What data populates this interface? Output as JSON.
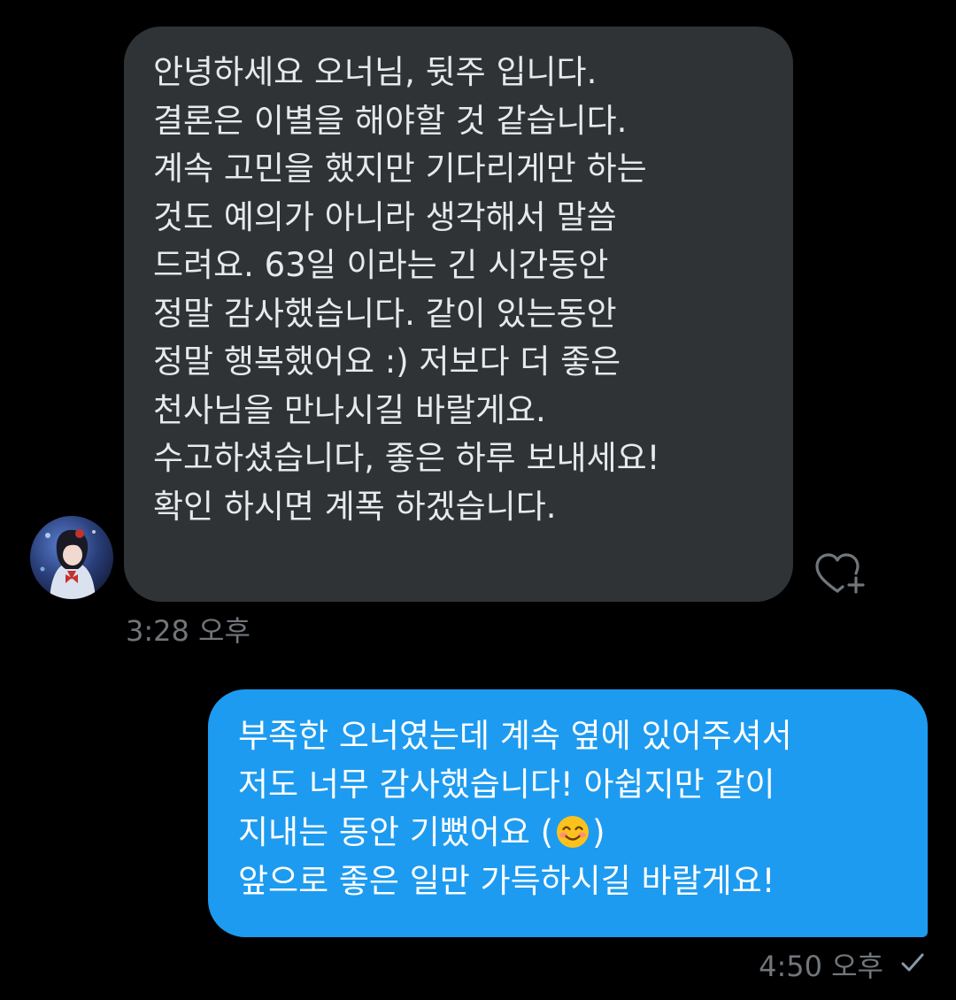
{
  "conversation": {
    "incoming": {
      "lines": [
        "안녕하세요 오너님, 뒷주 입니다.",
        "결론은 이별을 해야할 것 같습니다.",
        "계속 고민을 했지만 기다리게만 하는",
        "것도 예의가 아니라 생각해서 말씀",
        "드려요. 63일 이라는 긴 시간동안",
        "정말 감사했습니다. 같이 있는동안",
        "정말 행복했어요 :) 저보다 더 좋은",
        "천사님을 만나시길 바랄게요.",
        "수고하셨습니다, 좋은 하루 보내세요!",
        "확인 하시면 계폭 하겠습니다."
      ],
      "time": "3:28 오후"
    },
    "outgoing": {
      "lines": [
        "부족한 오너였는데 계속 옆에 있어주셔서",
        "저도 너무 감사했습니다! 아쉽지만 같이",
        "지내는 동안 기뻤어요 (",
        ")",
        "앞으로 좋은 일만 가득하시길 바랄게요!"
      ],
      "emoji": "smiling-face-with-smiling-eyes-emoji",
      "time": "4:50 오후"
    }
  },
  "icons": {
    "react": "heart-plus-icon",
    "status": "check-icon"
  },
  "colors": {
    "background": "#000000",
    "incoming_bubble": "#2f3336",
    "outgoing_bubble": "#1d9bf0",
    "timestamp": "#71767b"
  }
}
